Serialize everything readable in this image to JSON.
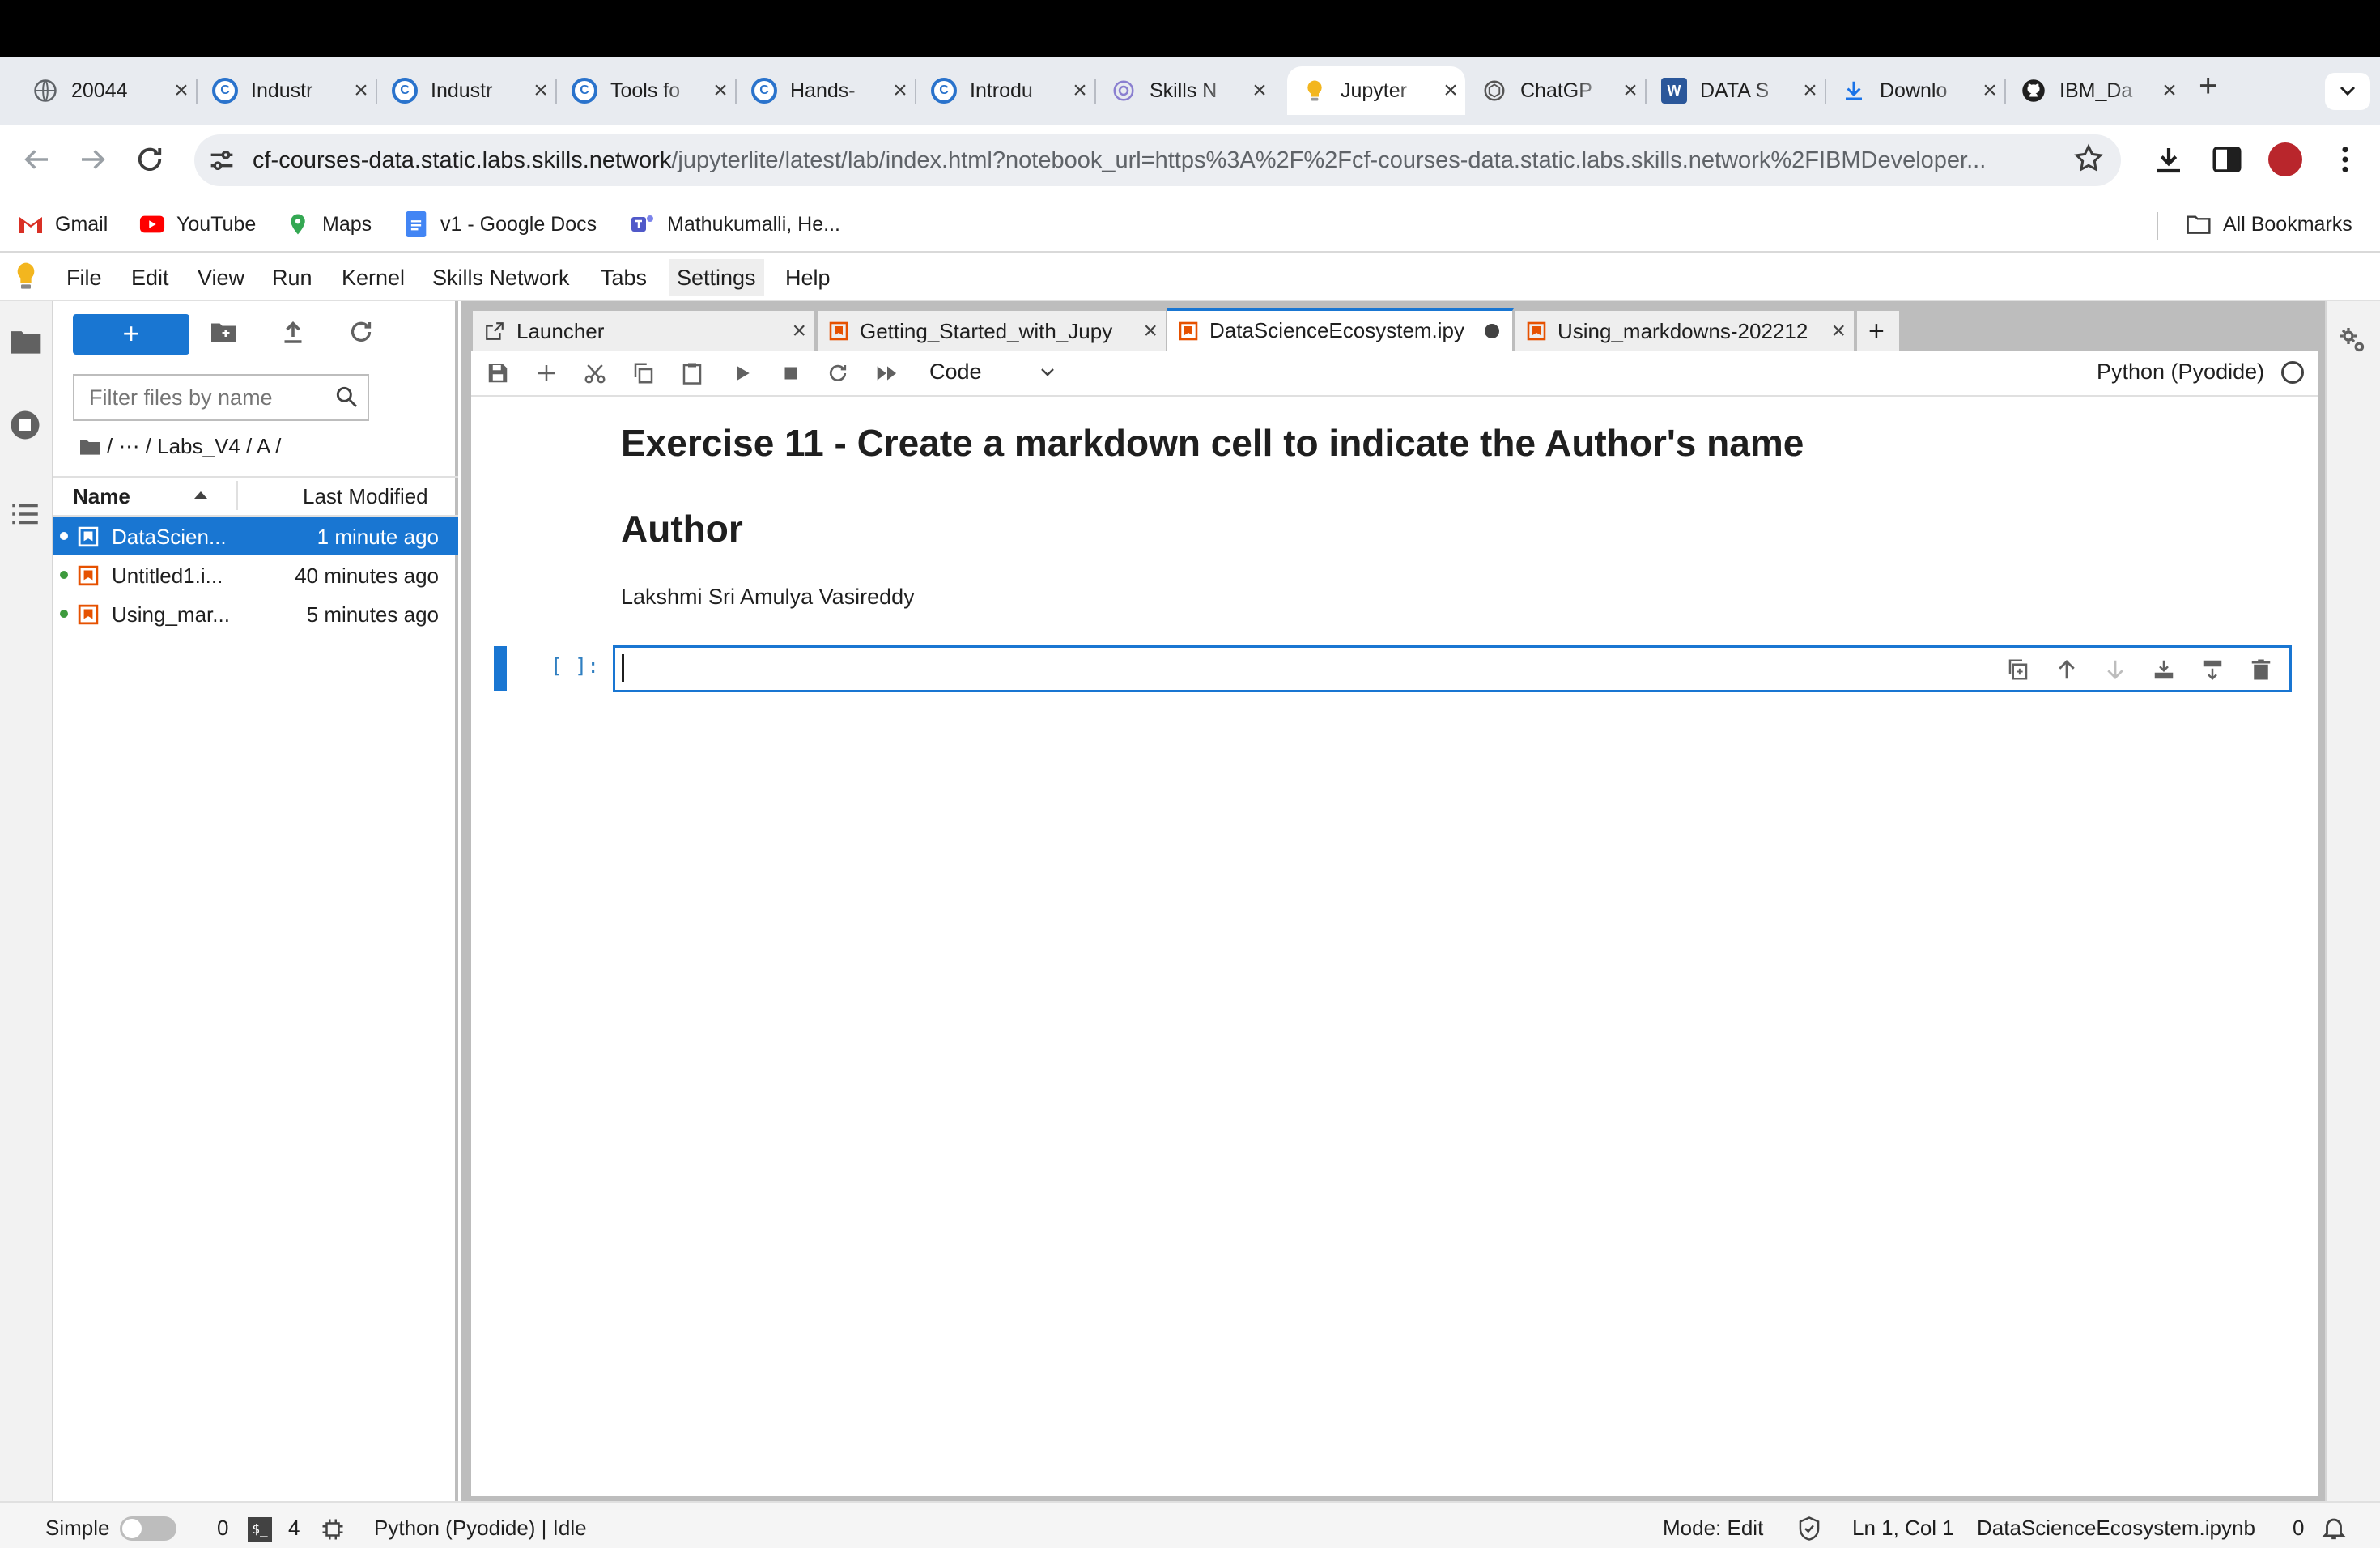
{
  "browser": {
    "tabs": [
      {
        "label": "20044",
        "icon": "globe-icon"
      },
      {
        "label": "Industr",
        "icon": "coursera-icon"
      },
      {
        "label": "Industr",
        "icon": "coursera-icon"
      },
      {
        "label": "Tools fo",
        "icon": "coursera-icon"
      },
      {
        "label": "Hands-",
        "icon": "coursera-icon"
      },
      {
        "label": "Introdu",
        "icon": "coursera-icon"
      },
      {
        "label": "Skills N",
        "icon": "skills-network-icon"
      },
      {
        "label": "Jupyter",
        "icon": "jupyterlite-icon"
      },
      {
        "label": "ChatGP",
        "icon": "chatgpt-icon"
      },
      {
        "label": "DATA S",
        "icon": "word-icon"
      },
      {
        "label": "Downlo",
        "icon": "download-icon"
      },
      {
        "label": "IBM_Da",
        "icon": "github-icon"
      }
    ],
    "active_tab_index": 7,
    "url_host": "cf-courses-data.static.labs.skills.network",
    "url_path": "/jupyterlite/latest/lab/index.html?notebook_url=https%3A%2F%2Fcf-courses-data.static.labs.skills.network%2FIBMDeveloper...",
    "bookmarks": [
      {
        "label": "Gmail",
        "icon": "gmail-icon"
      },
      {
        "label": "YouTube",
        "icon": "youtube-icon"
      },
      {
        "label": "Maps",
        "icon": "maps-icon"
      },
      {
        "label": "v1 - Google Docs",
        "icon": "docs-icon"
      },
      {
        "label": "Mathukumalli, He...",
        "icon": "teams-icon"
      }
    ],
    "all_bookmarks_label": "All Bookmarks"
  },
  "menu": [
    "File",
    "Edit",
    "View",
    "Run",
    "Kernel",
    "Skills Network",
    "Tabs",
    "Settings",
    "Help"
  ],
  "menu_highlighted": "Settings",
  "filebrowser": {
    "new_label": "+",
    "filter_placeholder": "Filter files by name",
    "breadcrumb": "/   ⋯   / Labs_V4 / A /",
    "col_name": "Name",
    "col_modified": "Last Modified",
    "files": [
      {
        "name": "DataScien...",
        "modified": "1 minute ago",
        "selected": true
      },
      {
        "name": "Untitled1.i...",
        "modified": "40 minutes ago",
        "selected": false
      },
      {
        "name": "Using_mar...",
        "modified": "5 minutes ago",
        "selected": false
      }
    ]
  },
  "notebook_tabs": [
    {
      "label": "Launcher",
      "icon": "launcher-icon"
    },
    {
      "label": "Getting_Started_with_Jupy",
      "icon": "notebook-icon"
    },
    {
      "label": "DataScienceEcosystem.ipy",
      "icon": "notebook-icon"
    },
    {
      "label": "Using_markdowns-202212",
      "icon": "notebook-icon"
    }
  ],
  "toolbar": {
    "cell_type": "Code",
    "kernel": "Python (Pyodide)"
  },
  "notebook": {
    "heading1": "Exercise 11 - Create a markdown cell to indicate the Author's name",
    "heading2": "Author",
    "paragraph": "Lakshmi Sri Amulya Vasireddy",
    "prompt": "[ ]:"
  },
  "status": {
    "mode_label": "Simple",
    "count_a": "0",
    "count_b": "4",
    "kernel_status": "Python (Pyodide) | Idle",
    "mode": "Mode: Edit",
    "position": "Ln 1, Col 1",
    "filename": "DataScienceEcosystem.ipynb",
    "notifications": "0"
  },
  "colors": {
    "accent": "#1976d2",
    "selection": "#1976d2",
    "notebook_icon": "#e65100"
  }
}
